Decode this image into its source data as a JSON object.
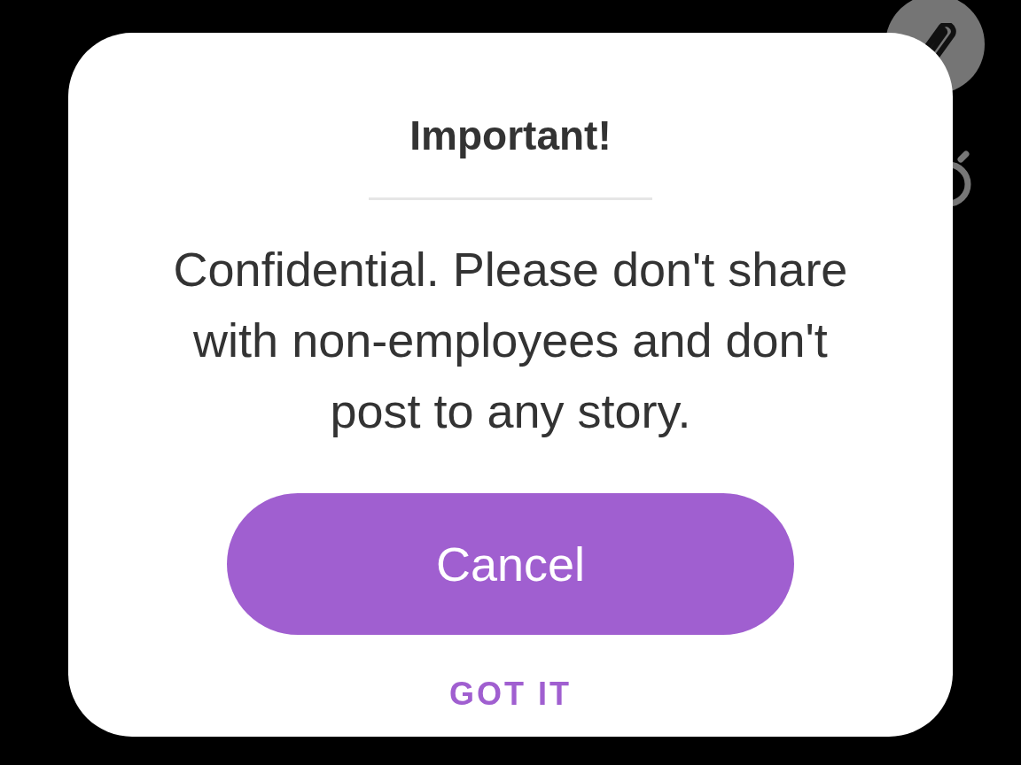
{
  "dialog": {
    "title": "Important!",
    "message": "Confidential. Please don't share with non-employees and don't post to any story.",
    "primary_button": "Cancel",
    "secondary_button": "GOT IT"
  }
}
